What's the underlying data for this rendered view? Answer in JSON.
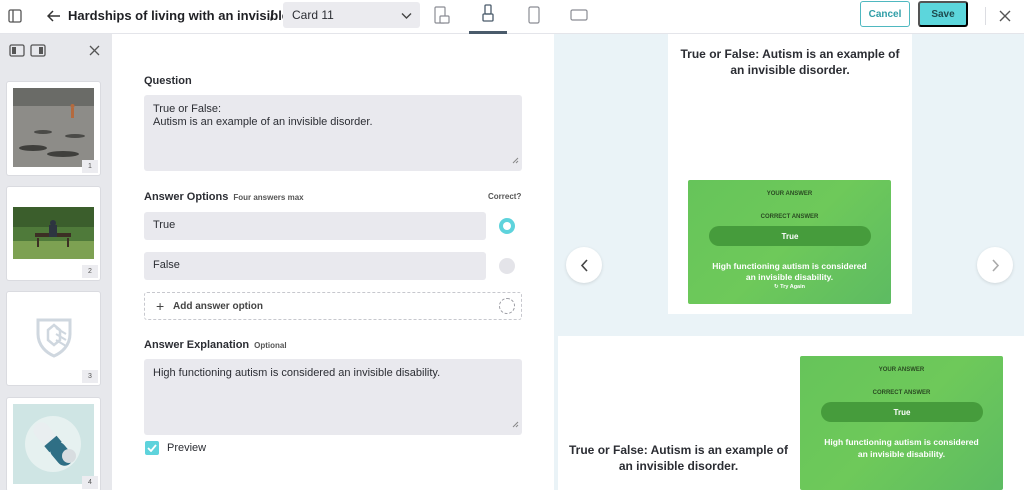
{
  "header": {
    "title": "Hardships of living with an invisible…",
    "separator": "/",
    "card_select": "Card 11",
    "cancel_label": "Cancel",
    "save_label": "Save"
  },
  "sidebar": {
    "thumbnails": [
      {
        "num": "1",
        "desc": "sidewalk-photo"
      },
      {
        "num": "2",
        "desc": "park-bench-photo"
      },
      {
        "num": "3",
        "desc": "shield-logo"
      },
      {
        "num": "4",
        "desc": "capsule-illustration"
      }
    ]
  },
  "editor": {
    "question_label": "Question",
    "question_line1": "True or False:",
    "question_line2": "Autism is an example of an invisible disorder.",
    "answer_options_label": "Answer Options",
    "answer_options_hint": "Four answers max",
    "correct_label": "Correct?",
    "options": [
      {
        "text": "True",
        "correct": true
      },
      {
        "text": "False",
        "correct": false
      }
    ],
    "add_option_label": "Add answer option",
    "explanation_label": "Answer Explanation",
    "explanation_hint": "Optional",
    "explanation_text": "High functioning autism is considered an invisible disability.",
    "preview_label": "Preview"
  },
  "preview": {
    "question_line1": "True or False: Autism is an example of",
    "question_line2": "an invisible disorder.",
    "your_answer": "YOUR ANSWER",
    "correct_answer": "CORRECT ANSWER",
    "answer_value": "True",
    "explanation_line1": "High functioning autism is considered",
    "explanation_line2": "an invisible disability.",
    "try_again": "Try Again"
  },
  "colors": {
    "accent": "#5cd6dc",
    "accent_dark": "#2f9ea7",
    "green": "#66c45a"
  }
}
